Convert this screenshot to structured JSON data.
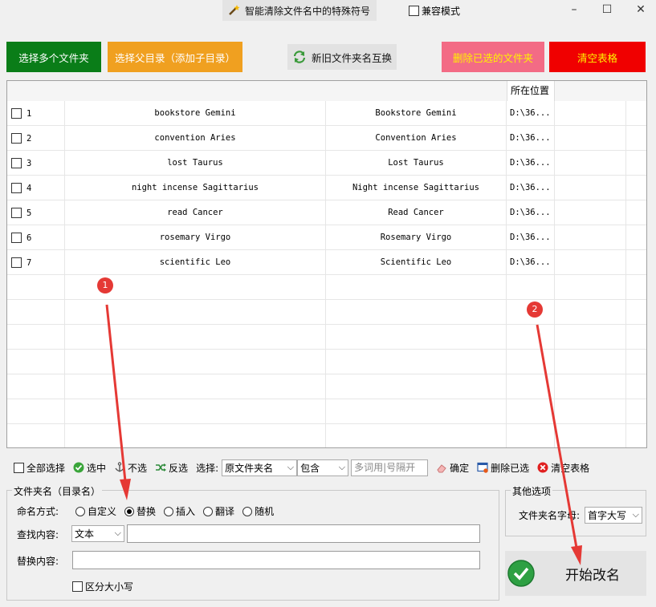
{
  "window": {
    "title": "智能清除文件名中的特殊符号",
    "compat_mode": "兼容模式",
    "minimize": "–",
    "maximize": "☐",
    "close": "✕"
  },
  "toolbar": {
    "select_folders": "选择多个文件夹",
    "select_parent": "选择父目录（添加子目录）",
    "swap_names": "新旧文件夹名互换",
    "delete_selected": "删除已选的文件夹",
    "clear_table": "清空表格"
  },
  "table": {
    "header_location": "所在位置",
    "rows": [
      {
        "num": "1",
        "old": "bookstore Gemini",
        "new": "Bookstore Gemini",
        "loc": "D:\\36..."
      },
      {
        "num": "2",
        "old": "convention Aries",
        "new": "Convention Aries",
        "loc": "D:\\36..."
      },
      {
        "num": "3",
        "old": "lost Taurus",
        "new": "Lost Taurus",
        "loc": "D:\\36..."
      },
      {
        "num": "4",
        "old": "night incense Sagittarius",
        "new": "Night incense Sagittarius",
        "loc": "D:\\36..."
      },
      {
        "num": "5",
        "old": "read Cancer",
        "new": "Read Cancer",
        "loc": "D:\\36..."
      },
      {
        "num": "6",
        "old": "rosemary Virgo",
        "new": "Rosemary Virgo",
        "loc": "D:\\36..."
      },
      {
        "num": "7",
        "old": "scientific Leo",
        "new": "Scientific Leo",
        "loc": "D:\\36..."
      }
    ]
  },
  "selection": {
    "select_all": "全部选择",
    "select": "选中",
    "deselect": "不选",
    "invert": "反选",
    "choose_label": "选择:",
    "field_value": "原文件夹名",
    "mode_value": "包含",
    "keywords_placeholder": "多词用|号隔开",
    "confirm": "确定",
    "delete_selected": "删除已选",
    "clear_table": "清空表格"
  },
  "folder_group": {
    "title": "文件夹名（目录名）",
    "naming_label": "命名方式:",
    "options": [
      "自定义",
      "替换",
      "插入",
      "翻译",
      "随机"
    ],
    "selected_option": "替换",
    "find_label": "查找内容:",
    "find_type": "文本",
    "find_value": "",
    "replace_label": "替换内容:",
    "replace_value": "",
    "case_sensitive": "区分大小写"
  },
  "other_group": {
    "title": "其他选项",
    "first_letter_label": "文件夹名字母:",
    "first_letter_value": "首字大写"
  },
  "start_button": "开始改名",
  "annotations": [
    "1",
    "2"
  ],
  "colors": {
    "green": "#0a7d18",
    "orange": "#f0a020",
    "pink": "#f36b85",
    "red": "#f00000",
    "yellow_text": "#fff300",
    "annotation_red": "#e53935"
  }
}
